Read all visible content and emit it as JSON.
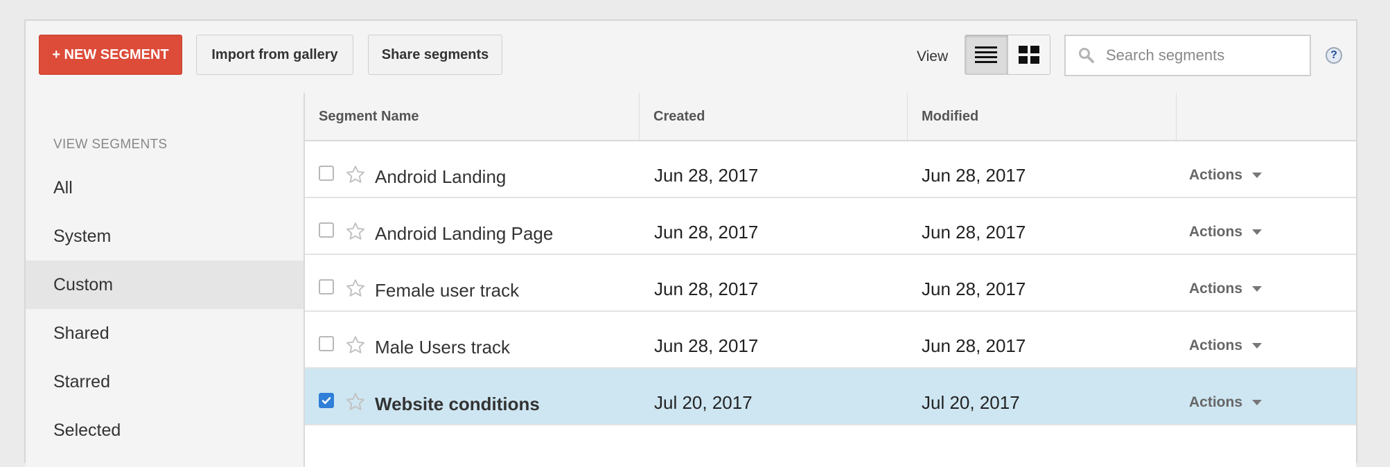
{
  "toolbar": {
    "new_segment_label": "+ NEW SEGMENT",
    "import_label": "Import from gallery",
    "share_label": "Share segments",
    "view_label": "View",
    "search_placeholder": "Search segments",
    "help_label": "?"
  },
  "sidebar": {
    "header": "VIEW SEGMENTS",
    "items": [
      {
        "label": "All",
        "active": false
      },
      {
        "label": "System",
        "active": false
      },
      {
        "label": "Custom",
        "active": true
      },
      {
        "label": "Shared",
        "active": false
      },
      {
        "label": "Starred",
        "active": false
      },
      {
        "label": "Selected",
        "active": false
      }
    ]
  },
  "table": {
    "columns": [
      "Segment Name",
      "Created",
      "Modified",
      ""
    ],
    "rows": [
      {
        "name": "Android Landing",
        "created": "Jun 28, 2017",
        "modified": "Jun 28, 2017",
        "actions": "Actions",
        "checked": false
      },
      {
        "name": "Android Landing Page",
        "created": "Jun 28, 2017",
        "modified": "Jun 28, 2017",
        "actions": "Actions",
        "checked": false
      },
      {
        "name": "Female user track",
        "created": "Jun 28, 2017",
        "modified": "Jun 28, 2017",
        "actions": "Actions",
        "checked": false
      },
      {
        "name": "Male Users track",
        "created": "Jun 28, 2017",
        "modified": "Jun 28, 2017",
        "actions": "Actions",
        "checked": false
      },
      {
        "name": "Website conditions",
        "created": "Jul 20, 2017",
        "modified": "Jul 20, 2017",
        "actions": "Actions",
        "checked": true
      }
    ]
  },
  "colors": {
    "new_button": "#dd4b39",
    "selected_row": "#cee6f2",
    "checkbox_checked": "#2f7fd8"
  },
  "icons": {
    "view_list": "list-view-icon",
    "view_grid": "grid-view-icon",
    "search": "search-icon",
    "star": "star-outline-icon",
    "dropdown": "caret-down-icon"
  }
}
